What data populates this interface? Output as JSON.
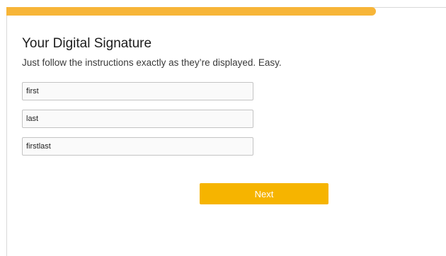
{
  "progress": {
    "value": 0.84,
    "color": "#f7b538"
  },
  "form": {
    "title": "Your Digital Signature",
    "subtitle": "Just follow the instructions exactly as they’re displayed. Easy.",
    "fields": [
      {
        "value": "first"
      },
      {
        "value": "last"
      },
      {
        "value": "firstlast"
      }
    ]
  },
  "actions": {
    "next_label": "Next",
    "next_color": "#f6b400"
  }
}
